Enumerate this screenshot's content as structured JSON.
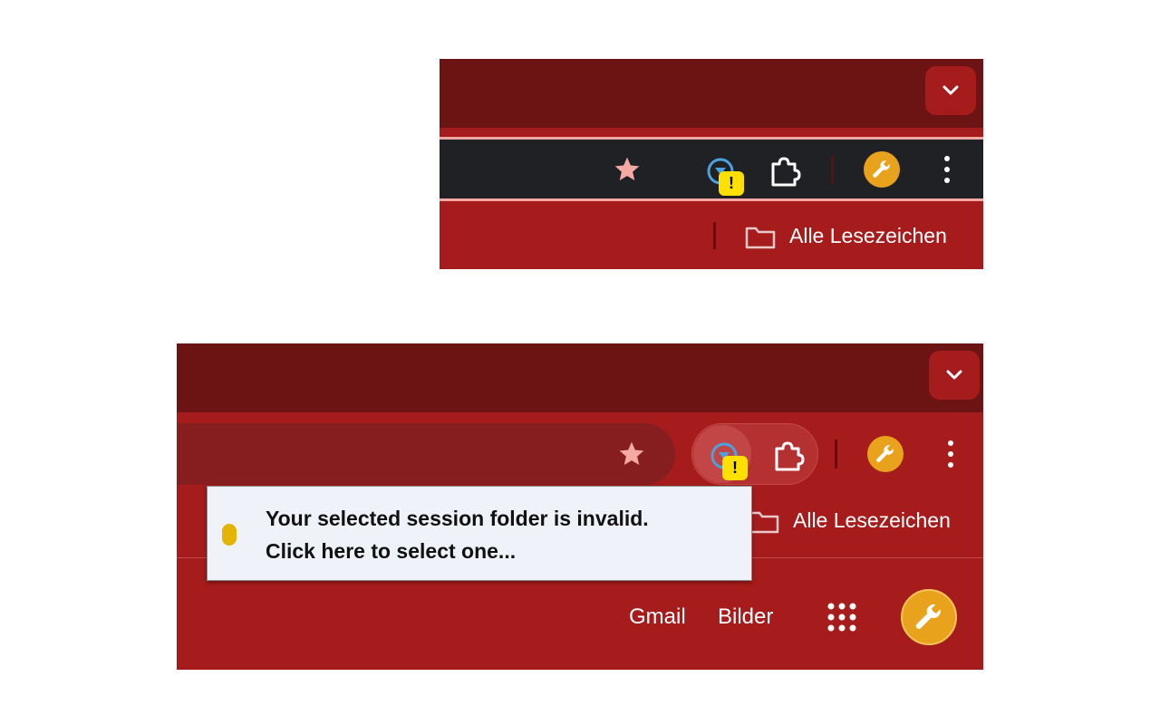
{
  "top_panel": {
    "tab_search_icon": "chevron-down-icon",
    "extension_icon": "session-extension-icon",
    "warning_badge": "!",
    "puzzle_icon": "puzzle-piece-icon",
    "profile_icon": "wrench-icon",
    "menu_icon": "three-dot-menu-icon",
    "bookmark_folder_icon": "folder-icon",
    "bookmark_label": "Alle Lesezeichen"
  },
  "bottom_panel": {
    "tab_search_icon": "chevron-down-icon",
    "extension_icon": "session-extension-icon",
    "warning_badge": "!",
    "puzzle_icon": "puzzle-piece-icon",
    "profile_icon": "wrench-icon",
    "menu_icon": "three-dot-menu-icon",
    "bookmark_folder_icon": "folder-icon",
    "bookmark_label": "Alle Lesezeichen",
    "tooltip": {
      "line1": "Your selected session folder is invalid.",
      "line2": "Click here to select one..."
    },
    "page_links": {
      "gmail": "Gmail",
      "images": "Bilder"
    },
    "apps_icon": "apps-grid-icon",
    "account_icon": "wrench-icon"
  },
  "colors": {
    "tab_strip": "#6c1313",
    "toolbar": "#a61b1b",
    "omnibox_dark": "#202124",
    "omnibox_border": "#f2a7a3",
    "star": "#f4a9a3",
    "badge": "#ffe000",
    "profile": "#e8a21c",
    "tooltip_bg": "#eff2f8",
    "tooltip_dot": "#e5b400"
  }
}
